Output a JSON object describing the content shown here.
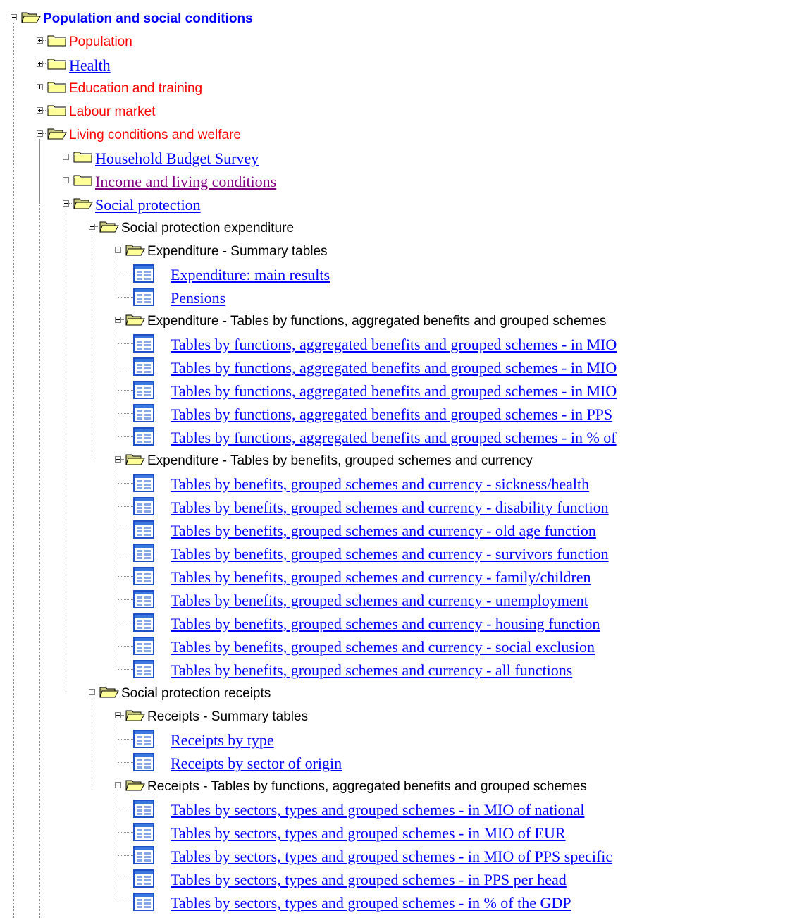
{
  "colors": {
    "link": "#0000ff",
    "visited_link": "#800080",
    "red_label": "#ff0000",
    "plain_label": "#000000",
    "folder": "#ffff99",
    "tree_line": "#8a8a8a"
  },
  "tree": {
    "root": {
      "label": "Population and social conditions",
      "state": "expanded",
      "icon": "folder-open-icon"
    },
    "population": {
      "label": "Population",
      "state": "collapsed",
      "icon": "folder-icon"
    },
    "health": {
      "label": "Health",
      "state": "collapsed",
      "icon": "folder-icon"
    },
    "education": {
      "label": "Education and training",
      "state": "collapsed",
      "icon": "folder-icon"
    },
    "labour": {
      "label": "Labour market",
      "state": "collapsed",
      "icon": "folder-icon"
    },
    "living": {
      "label": "Living conditions and welfare",
      "state": "expanded",
      "icon": "folder-open-icon"
    },
    "household": {
      "label": "Household Budget Survey",
      "state": "collapsed",
      "icon": "folder-icon"
    },
    "income": {
      "label": "Income and living conditions",
      "state": "collapsed",
      "icon": "folder-icon"
    },
    "social_protection": {
      "label": "Social protection",
      "state": "expanded",
      "icon": "folder-open-icon"
    },
    "sp_expenditure": {
      "label": "Social protection expenditure",
      "state": "expanded",
      "icon": "folder-open-icon"
    },
    "exp_summary": {
      "label": "Expenditure - Summary tables",
      "state": "expanded",
      "icon": "folder-open-icon",
      "items": [
        "Expenditure: main results",
        "Pensions"
      ]
    },
    "exp_functions": {
      "label": "Expenditure - Tables by functions, aggregated benefits and grouped schemes",
      "state": "expanded",
      "icon": "folder-open-icon",
      "items": [
        "Tables by functions, aggregated benefits and grouped schemes - in MIO",
        "Tables by functions, aggregated benefits and grouped schemes - in MIO",
        "Tables by functions, aggregated benefits and grouped schemes - in MIO",
        "Tables by functions, aggregated benefits and grouped schemes - in PPS",
        "Tables by functions, aggregated benefits and grouped schemes - in % of"
      ]
    },
    "exp_benefits": {
      "label": "Expenditure - Tables by benefits, grouped schemes and currency",
      "state": "expanded",
      "icon": "folder-open-icon",
      "items": [
        "Tables by benefits, grouped schemes and currency - sickness/health",
        "Tables by benefits, grouped schemes and currency - disability function",
        "Tables by benefits, grouped schemes and currency - old age function",
        "Tables by benefits, grouped schemes and currency - survivors function",
        "Tables by benefits, grouped schemes and currency - family/children",
        "Tables by benefits, grouped schemes and currency - unemployment",
        "Tables by benefits, grouped schemes and currency - housing function",
        "Tables by benefits, grouped schemes and currency - social exclusion",
        "Tables by benefits, grouped schemes and currency - all functions"
      ]
    },
    "sp_receipts": {
      "label": "Social protection receipts",
      "state": "expanded",
      "icon": "folder-open-icon"
    },
    "rec_summary": {
      "label": "Receipts - Summary tables",
      "state": "expanded",
      "icon": "folder-open-icon",
      "items": [
        "Receipts by type",
        "Receipts by sector of origin"
      ]
    },
    "rec_functions": {
      "label": "Receipts - Tables by functions, aggregated benefits and grouped schemes",
      "state": "expanded",
      "icon": "folder-open-icon",
      "items": [
        "Tables by sectors, types and grouped schemes - in MIO of national",
        "Tables by sectors, types and grouped schemes - in MIO of EUR",
        "Tables by sectors, types and grouped schemes - in MIO of PPS specific",
        "Tables by sectors, types and grouped schemes - in PPS per head",
        "Tables by sectors, types and grouped schemes - in % of the GDP"
      ]
    }
  }
}
